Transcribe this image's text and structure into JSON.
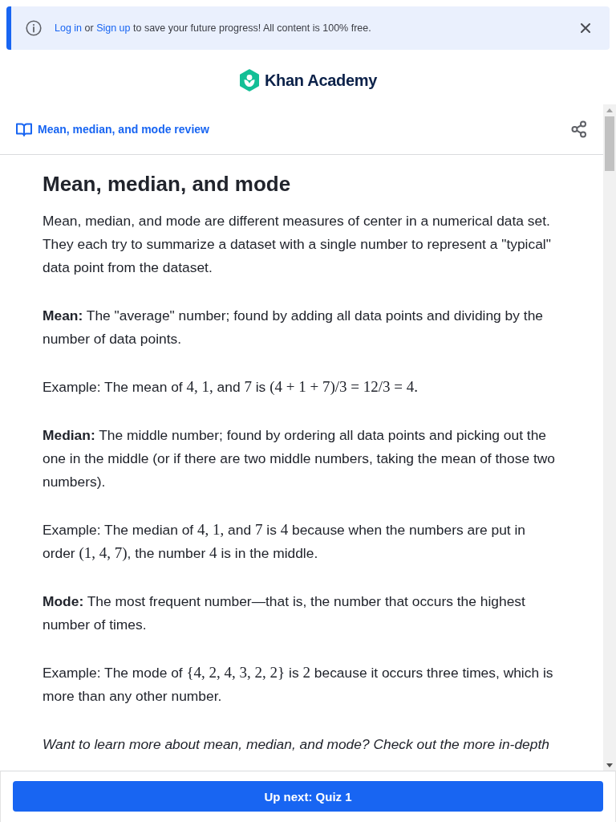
{
  "banner": {
    "segments": [
      {
        "kind": "link",
        "text": "Log in"
      },
      {
        "kind": "text",
        "text": " or "
      },
      {
        "kind": "link",
        "text": "Sign up"
      },
      {
        "kind": "text",
        "text": " to save your future progress! All content is 100% free."
      }
    ]
  },
  "logo": {
    "text": "Khan Academy"
  },
  "header": {
    "title": "Mean, median, and mode review"
  },
  "article": {
    "title": "Mean, median, and mode",
    "paragraphs": [
      {
        "kind": "normal",
        "segments": [
          {
            "kind": "text",
            "text": "Mean, median, and mode are different measures of center in a numerical data set. They each try to summarize a dataset with a single number to represent a \"typical\" data point from the dataset."
          }
        ]
      },
      {
        "kind": "normal",
        "segments": [
          {
            "kind": "bold",
            "text": "Mean:"
          },
          {
            "kind": "text",
            "text": " The \"average\" number; found by adding all data points and dividing by the number of data points."
          }
        ]
      },
      {
        "kind": "normal",
        "segments": [
          {
            "kind": "text",
            "text": "Example: The mean of "
          },
          {
            "kind": "math",
            "text": "4, 1,"
          },
          {
            "kind": "text",
            "text": " and "
          },
          {
            "kind": "math",
            "text": "7"
          },
          {
            "kind": "text",
            "text": " is "
          },
          {
            "kind": "math",
            "text": "(4 + 1 + 7)/3 = 12/3 = 4."
          }
        ]
      },
      {
        "kind": "normal",
        "segments": [
          {
            "kind": "bold",
            "text": "Median:"
          },
          {
            "kind": "text",
            "text": " The middle number; found by ordering all data points and picking out the one in the middle (or if there are two middle numbers, taking the mean of those two numbers)."
          }
        ]
      },
      {
        "kind": "normal",
        "segments": [
          {
            "kind": "text",
            "text": "Example: The median of "
          },
          {
            "kind": "math",
            "text": "4, 1,"
          },
          {
            "kind": "text",
            "text": " and "
          },
          {
            "kind": "math",
            "text": "7"
          },
          {
            "kind": "text",
            "text": " is "
          },
          {
            "kind": "math",
            "text": "4"
          },
          {
            "kind": "text",
            "text": " because when the numbers are put in order "
          },
          {
            "kind": "math",
            "text": "(1, 4, 7)"
          },
          {
            "kind": "text",
            "text": ", the number "
          },
          {
            "kind": "math",
            "text": "4"
          },
          {
            "kind": "text",
            "text": " is in the middle."
          }
        ]
      },
      {
        "kind": "normal",
        "segments": [
          {
            "kind": "bold",
            "text": "Mode:"
          },
          {
            "kind": "text",
            "text": " The most frequent number—that is, the number that occurs the highest number of times."
          }
        ]
      },
      {
        "kind": "normal",
        "segments": [
          {
            "kind": "text",
            "text": "Example: The mode of "
          },
          {
            "kind": "math",
            "text": "{4, 2, 4, 3, 2, 2}"
          },
          {
            "kind": "text",
            "text": " is "
          },
          {
            "kind": "math",
            "text": "2"
          },
          {
            "kind": "text",
            "text": " because it occurs three times, which is more than any other number."
          }
        ]
      },
      {
        "kind": "italic",
        "segments": [
          {
            "kind": "text",
            "text": "Want to learn more about mean, median, and mode? Check out the more in-depth"
          }
        ]
      }
    ]
  },
  "footer": {
    "button": "Up next: Quiz 1"
  }
}
